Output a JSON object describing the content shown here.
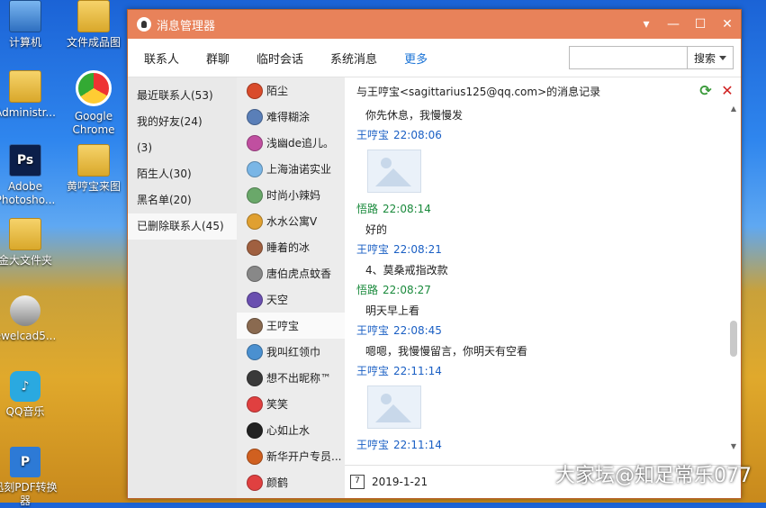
{
  "desktop": {
    "icons": [
      {
        "label": "计算机",
        "icon": "computer-icon"
      },
      {
        "label": "文件成品图",
        "icon": "folder-icon"
      },
      {
        "label": "Administr...",
        "icon": "user-folder-icon"
      },
      {
        "label": "Google Chrome",
        "icon": "chrome-icon"
      },
      {
        "label": "Adobe Photosho...",
        "icon": "photoshop-icon"
      },
      {
        "label": "黄哼宝来图",
        "icon": "folder-icon"
      },
      {
        "label": "金大文件夹",
        "icon": "folder-icon"
      },
      {
        "label": "ewelcad5...",
        "icon": "jewelcad-icon"
      },
      {
        "label": "QQ音乐",
        "icon": "qq-music-icon"
      },
      {
        "label": "迅刻PDF转换器",
        "icon": "pdf-converter-icon"
      }
    ]
  },
  "window": {
    "title": "消息管理器",
    "controls": {
      "menu": "▾",
      "minimize": "—",
      "maximize": "☐",
      "close": "✕"
    }
  },
  "menubar": {
    "tabs": [
      "联系人",
      "群聊",
      "临时会话",
      "系统消息",
      "更多"
    ],
    "active_tab": "更多",
    "search_placeholder": "",
    "search_button": "搜索"
  },
  "groups": [
    "最近联系人(53)",
    "我的好友(24)",
    "(3)",
    "陌生人(30)",
    "黑名单(20)",
    "已删除联系人(45)"
  ],
  "contacts": [
    {
      "name": "陌尘",
      "color": "#d94b2b"
    },
    {
      "name": "难得糊涂",
      "color": "#5a7fb8"
    },
    {
      "name": "浅幽de追儿。",
      "color": "#c04fa0"
    },
    {
      "name": "上海油诺实业",
      "color": "#7ab6e6"
    },
    {
      "name": "时尚小辣妈",
      "color": "#6aa86a"
    },
    {
      "name": "水水公寓V",
      "color": "#e0a030"
    },
    {
      "name": "睡着的冰",
      "color": "#a06040"
    },
    {
      "name": "唐伯虎点蚊香",
      "color": "#888888"
    },
    {
      "name": "天空",
      "color": "#6a4fb0"
    },
    {
      "name": "王哼宝",
      "color": "#8a6a50"
    },
    {
      "name": "我叫红领巾",
      "color": "#4a90d0"
    },
    {
      "name": "想不出昵称™",
      "color": "#3a3a3a"
    },
    {
      "name": "笑笑",
      "color": "#e04040"
    },
    {
      "name": "心如止水",
      "color": "#222222"
    },
    {
      "name": "新华开户专员...",
      "color": "#d06020"
    },
    {
      "name": "颜鹤",
      "color": "#e04040"
    }
  ],
  "selected_contact": "王哼宝",
  "chat": {
    "header": "与王哼宝<sagittarius125@qq.com>的消息记录",
    "messages": [
      {
        "kind": "text",
        "text": "你先休息，我慢慢发"
      },
      {
        "kind": "meta",
        "sender": "王哼宝",
        "time": "22:08:06",
        "color": "blue"
      },
      {
        "kind": "pic"
      },
      {
        "kind": "meta",
        "sender": "悟路",
        "time": "22:08:14",
        "color": "green"
      },
      {
        "kind": "text",
        "text": "好的"
      },
      {
        "kind": "meta",
        "sender": "王哼宝",
        "time": "22:08:21",
        "color": "blue"
      },
      {
        "kind": "text",
        "text": "4、莫桑戒指改款"
      },
      {
        "kind": "meta",
        "sender": "悟路",
        "time": "22:08:27",
        "color": "green"
      },
      {
        "kind": "text",
        "text": "明天早上看"
      },
      {
        "kind": "meta",
        "sender": "王哼宝",
        "time": "22:08:45",
        "color": "blue"
      },
      {
        "kind": "text",
        "text": "嗯嗯，我慢慢留言，你明天有空看"
      },
      {
        "kind": "meta",
        "sender": "王哼宝",
        "time": "22:11:14",
        "color": "blue"
      },
      {
        "kind": "pic"
      },
      {
        "kind": "meta",
        "sender": "王哼宝",
        "time": "22:11:14",
        "color": "blue"
      },
      {
        "kind": "pic"
      }
    ],
    "date": "2019-1-21",
    "calendar_day": "7"
  },
  "watermark": "大家坛@知足常乐077"
}
